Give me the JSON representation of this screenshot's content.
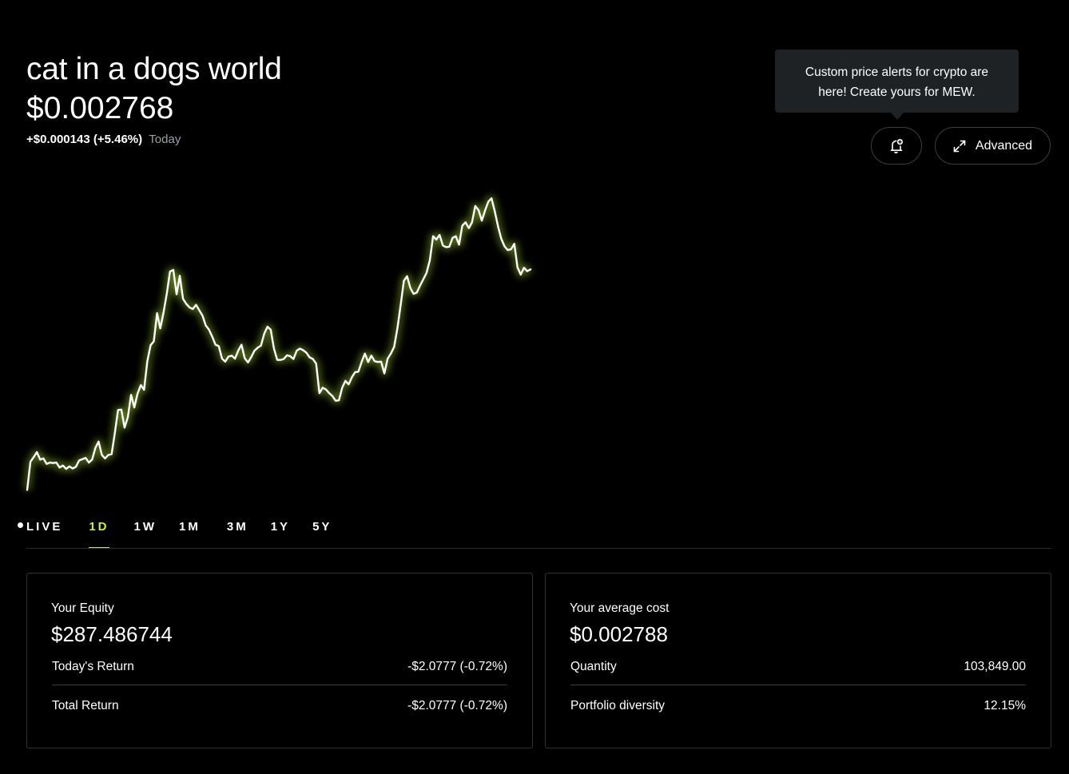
{
  "header": {
    "title": "cat in a dogs world",
    "price": "$0.002768",
    "change": "+$0.000143 (+5.46%)",
    "change_period": "Today"
  },
  "tooltip": {
    "text": "Custom price alerts for crypto are here! Create yours for MEW."
  },
  "actions": {
    "alert_icon": "bell-plus-icon",
    "advanced_icon": "expand-icon",
    "advanced_label": "Advanced"
  },
  "colors": {
    "background": "#000000",
    "line": "#ffffff",
    "glow": "#c3f53c",
    "accent": "#c3f53c"
  },
  "chart_data": {
    "type": "line",
    "series": [
      {
        "values": [
          0.002445,
          0.002512,
          0.002523,
          0.002535,
          0.002517,
          0.00252,
          0.002507,
          0.00251,
          0.002509,
          0.00251,
          0.002498,
          0.002503,
          0.002495,
          0.002501,
          0.002496,
          0.0025,
          0.002515,
          0.002518,
          0.002521,
          0.00251,
          0.002517,
          0.002545,
          0.00256,
          0.002528,
          0.00252,
          0.002528,
          0.00253,
          0.00258,
          0.002635,
          0.002636,
          0.002593,
          0.002618,
          0.002671,
          0.002641,
          0.002674,
          0.002694,
          0.002683,
          0.002751,
          0.002789,
          0.002798,
          0.002865,
          0.002829,
          0.002867,
          0.002912,
          0.002964,
          0.002968,
          0.00291,
          0.002954,
          0.002899,
          0.002887,
          0.002879,
          0.002875,
          0.002885,
          0.002872,
          0.002859,
          0.002836,
          0.002826,
          0.002809,
          0.00279,
          0.002787,
          0.002757,
          0.00275,
          0.002762,
          0.002764,
          0.002757,
          0.002776,
          0.00279,
          0.002758,
          0.002748,
          0.002761,
          0.002776,
          0.002783,
          0.002788,
          0.002816,
          0.002833,
          0.002826,
          0.002781,
          0.002754,
          0.002754,
          0.002756,
          0.002765,
          0.002763,
          0.002756,
          0.002776,
          0.002781,
          0.002777,
          0.002771,
          0.00276,
          0.002756,
          0.002745,
          0.002675,
          0.002688,
          0.002684,
          0.002675,
          0.002668,
          0.002657,
          0.002658,
          0.002688,
          0.002704,
          0.002696,
          0.002713,
          0.002725,
          0.002726,
          0.002749,
          0.002769,
          0.002749,
          0.002764,
          0.002751,
          0.002749,
          0.00275,
          0.002722,
          0.002757,
          0.002769,
          0.002785,
          0.002829,
          0.002883,
          0.002942,
          0.002953,
          0.002925,
          0.002911,
          0.002914,
          0.002931,
          0.002946,
          0.002961,
          0.002991,
          0.003048,
          0.00304,
          0.003051,
          0.003026,
          0.003022,
          0.003023,
          0.003044,
          0.003048,
          0.003028,
          0.003073,
          0.003081,
          0.003067,
          0.003081,
          0.00312,
          0.00311,
          0.003085,
          0.003109,
          0.00313,
          0.003138,
          0.003107,
          0.003071,
          0.003042,
          0.003024,
          0.003015,
          0.003017,
          0.00303,
          0.002974,
          0.002957,
          0.002973,
          0.002965,
          0.002969
        ]
      }
    ],
    "grid": false,
    "axes_visible": false,
    "ylim": [
      0.00244,
      0.00315
    ]
  },
  "range_tabs": {
    "items": [
      "LIVE",
      "1D",
      "1W",
      "1M",
      "3M",
      "1Y",
      "5Y"
    ],
    "active": "1D"
  },
  "equity_card": {
    "label": "Your Equity",
    "value": "$287.486744",
    "rows": [
      {
        "label": "Today's Return",
        "value": "-$2.0777 (-0.72%)"
      },
      {
        "label": "Total Return",
        "value": "-$2.0777 (-0.72%)"
      }
    ]
  },
  "cost_card": {
    "label": "Your average cost",
    "value": "$0.002788",
    "rows": [
      {
        "label": "Quantity",
        "value": "103,849.00"
      },
      {
        "label": "Portfolio diversity",
        "value": "12.15%"
      }
    ]
  }
}
